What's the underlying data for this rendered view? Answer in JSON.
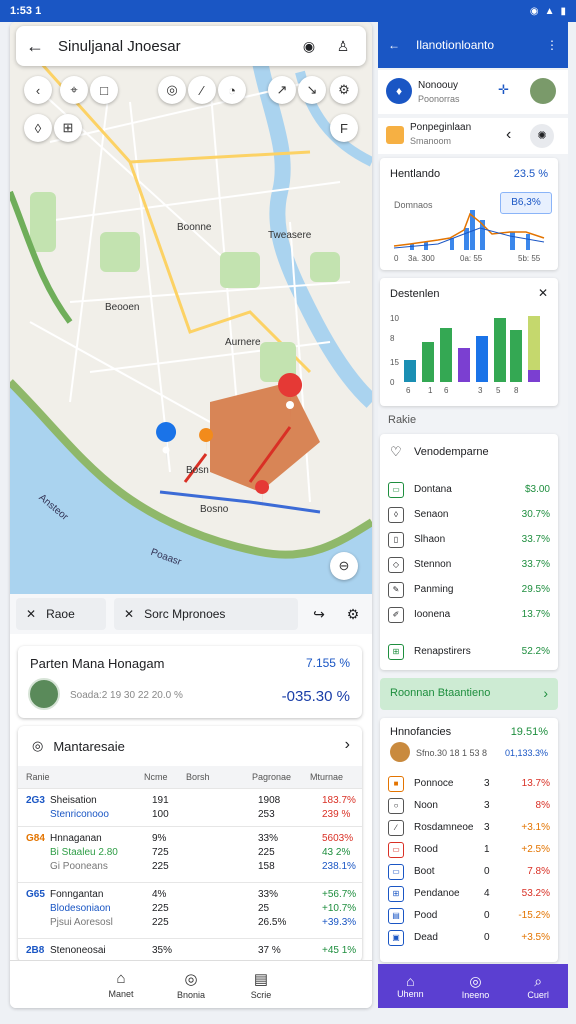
{
  "status": {
    "time": "1:53 1",
    "icons": [
      "wifi-icon",
      "signal-icon",
      "battery-icon"
    ]
  },
  "search": {
    "query": "Sinuljanal Jnoesar"
  },
  "map": {
    "labels": [
      "Boonne",
      "Tweasere",
      "Beooen",
      "Aurnere",
      "Bosn",
      "Bosno",
      "Ansteor",
      "Poaasr"
    ],
    "pins": [
      "red-pin",
      "blue-pin",
      "orange-pin"
    ]
  },
  "toolbar": {
    "chip1": "Raoe",
    "chip2": "Sorc Mpronoes"
  },
  "patient": {
    "title": "Parten Mana Honagam",
    "pct": "7.155 %",
    "sub": "Soada:2 19 30 22 20.0 %",
    "value": "-035.30 %"
  },
  "market": {
    "title": "Mantaresaie",
    "headers": [
      "Ranie",
      "Ncme",
      "Borsh",
      "Pagronae",
      "Mturnae"
    ],
    "rows": [
      {
        "code": "2G3",
        "name": "Sheisation",
        "sub": "Stenriconooo",
        "c2": "191",
        "c2b": "100",
        "c3": "1908",
        "c3b": "253",
        "c4": "183.7%",
        "c4b": "239 %",
        "col": "red"
      },
      {
        "code": "G84",
        "name": "Hnnaganan",
        "sub": "Bi Staaleu  2.80",
        "sub2": "Gi Pooneans",
        "c2": "9%",
        "c2b": "725",
        "c2c": "225",
        "c3": "33%",
        "c3b": "225",
        "c3c": "158",
        "c4": "5603%",
        "c4b": "43 2%",
        "c4c": "238.1%",
        "col": "red"
      },
      {
        "code": "G65",
        "name": "Fonngantan",
        "sub": "Blodesoniaon",
        "sub2": "Pjsui Aoresosl",
        "c2": "4%",
        "c2b": "225",
        "c2c": "225",
        "c3": "33%",
        "c3b": "25",
        "c3c": "26.5%",
        "c4": "+56.7%",
        "c4b": "+10.7%",
        "c4c": "+39.3%",
        "col": "green"
      },
      {
        "code": "2B8",
        "name": "Stenoneosai",
        "c2": "35%",
        "c3": "37 %",
        "c4": "+45 1%",
        "col": "green"
      }
    ]
  },
  "bottom_nav": [
    "Manet",
    "Bnonia",
    "Scrie"
  ],
  "right": {
    "header": "Ilanotionloanto",
    "profile": {
      "name": "Nonoouy",
      "sub": "Poonorras"
    },
    "notice": {
      "title": "Ponpeginlaan",
      "sub": "Smanoom"
    },
    "card1": {
      "title": "Hentlando",
      "pct": "23.5 %",
      "sub": "Domnaos",
      "box": "B6,3%",
      "xticks": [
        "0",
        "3a. 300",
        "0a: 55",
        "5b: 55"
      ]
    },
    "card2": {
      "title": "Destenlen",
      "yticks": [
        "10",
        "8",
        "15",
        "0"
      ],
      "xticks": [
        "6",
        "1",
        "6",
        "3",
        "5",
        "8"
      ]
    },
    "section": "Rakie",
    "list": {
      "title": "Venodemparne",
      "items": [
        {
          "name": "Dontana",
          "val": "$3.00",
          "col": "green"
        },
        {
          "name": "Senaon",
          "val": "30.7%",
          "col": "green"
        },
        {
          "name": "Slhaon",
          "val": "33.7%",
          "col": "green"
        },
        {
          "name": "Stennon",
          "val": "33.7%",
          "col": "green"
        },
        {
          "name": "Panming",
          "val": "29.5%",
          "col": "green"
        },
        {
          "name": "Ioonena",
          "val": "13.7%",
          "col": "green"
        },
        {
          "name": "Renapstirers",
          "val": "52.2%",
          "col": "green"
        }
      ]
    },
    "banner": "Roonnan Btaantieno",
    "card3": {
      "title": "Hnnofancies",
      "pct": "19.51%",
      "sub": "Sfno.30 18 1 53 8",
      "sub2": "01,133.3%",
      "rows": [
        {
          "name": "Ponnoce",
          "n": "3",
          "val": "13.7%",
          "col": "red"
        },
        {
          "name": "Noon",
          "n": "3",
          "val": "8%",
          "col": "red"
        },
        {
          "name": "Rosdamneoe",
          "n": "3",
          "val": "+3.1%",
          "col": "orange"
        },
        {
          "name": "Rood",
          "n": "1",
          "val": "+2.5%",
          "col": "orange"
        },
        {
          "name": "Boot",
          "n": "0",
          "val": "7.8%",
          "col": "red"
        },
        {
          "name": "Pendanoe",
          "n": "4",
          "val": "53.2%",
          "col": "red"
        },
        {
          "name": "Pood",
          "n": "0",
          "val": "-15.2%",
          "col": "orange"
        },
        {
          "name": "Dead",
          "n": "0",
          "val": "+3.5%",
          "col": "orange"
        }
      ]
    },
    "nav": [
      "Uhenn",
      "Ineeno",
      "Cuerl"
    ]
  },
  "colors": {
    "accent": "#1a56c4",
    "nav_purple": "#5b3fd1",
    "green": "#1e8e3e",
    "red": "#d93025"
  }
}
